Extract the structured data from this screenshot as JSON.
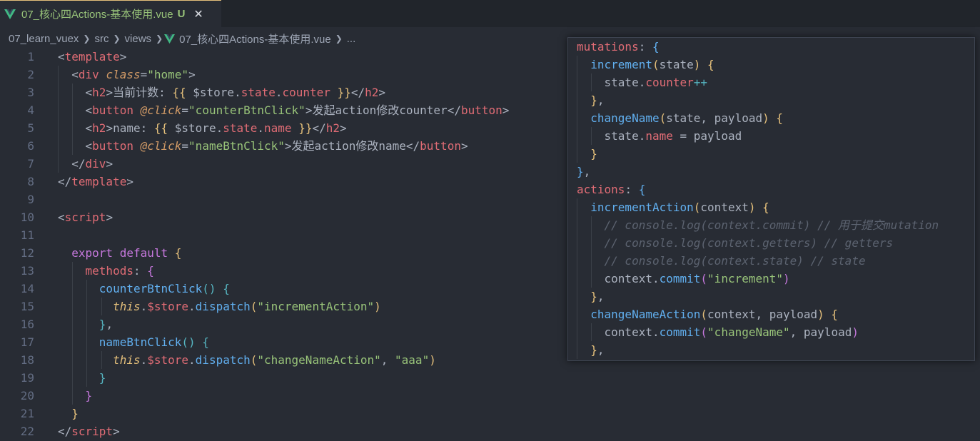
{
  "tab": {
    "title": "07_核心四Actions-基本使用.vue",
    "status": "U",
    "close": "✕"
  },
  "breadcrumb": {
    "items": [
      "07_learn_vuex",
      "src",
      "views",
      "07_核心四Actions-基本使用.vue",
      "..."
    ]
  },
  "colors": {
    "background": "#282c34",
    "tag": "#e06c75",
    "string": "#98c379",
    "attribute": "#d19a66",
    "function": "#61afef",
    "keyword": "#c678dd",
    "comment": "#5c6370",
    "vue_icon": "#41b883"
  },
  "editor": {
    "line_numbers": [
      "1",
      "2",
      "3",
      "4",
      "5",
      "6",
      "7",
      "8",
      "9",
      "10",
      "11",
      "12",
      "13",
      "14",
      "15",
      "16",
      "17",
      "18",
      "19",
      "20",
      "21",
      "22"
    ],
    "l1": {
      "a": "<",
      "b": "template",
      "c": ">"
    },
    "l2": {
      "a": "<",
      "b": "div",
      "c": "class",
      "d": "=",
      "e": "\"home\"",
      "f": ">"
    },
    "l3": {
      "a": "<",
      "b": "h2",
      "c": ">",
      "d": "当前计数: ",
      "e": "{{",
      "f": " $store",
      "g": ".",
      "h": "state",
      "i": ".",
      "j": "counter",
      "k": " }}",
      "l": "</",
      "m": "h2",
      "n": ">"
    },
    "l4": {
      "a": "<",
      "b": "button",
      "c": " @click",
      "d": "=",
      "e": "\"counterBtnClick\"",
      "f": ">",
      "g": "发起action修改counter",
      "h": "</",
      "i": "button",
      "j": ">"
    },
    "l5": {
      "a": "<",
      "b": "h2",
      "c": ">",
      "d": "name: ",
      "e": "{{",
      "f": " $store",
      "g": ".",
      "h": "state",
      "i": ".",
      "j": "name",
      "k": " }}",
      "l": "</",
      "m": "h2",
      "n": ">"
    },
    "l6": {
      "a": "<",
      "b": "button",
      "c": " @click",
      "d": "=",
      "e": "\"nameBtnClick\"",
      "f": ">",
      "g": "发起action修改name",
      "h": "</",
      "i": "button",
      "j": ">"
    },
    "l7": {
      "a": "</",
      "b": "div",
      "c": ">"
    },
    "l8": {
      "a": "</",
      "b": "template",
      "c": ">"
    },
    "l10": {
      "a": "<",
      "b": "script",
      "c": ">"
    },
    "l12": {
      "a": "export",
      "b": " default",
      "c": " {"
    },
    "l13": {
      "a": "methods",
      "b": ": ",
      "c": "{"
    },
    "l14": {
      "a": "counterBtnClick",
      "b": "()",
      "c": " {"
    },
    "l15": {
      "a": "this",
      "b": ".",
      "c": "$store",
      "d": ".",
      "e": "dispatch",
      "f": "(",
      "g": "\"incrementAction\"",
      "h": ")"
    },
    "l16": {
      "a": "}",
      "b": ","
    },
    "l17": {
      "a": "nameBtnClick",
      "b": "()",
      "c": " {"
    },
    "l18": {
      "a": "this",
      "b": ".",
      "c": "$store",
      "d": ".",
      "e": "dispatch",
      "f": "(",
      "g": "\"changeNameAction\"",
      "h": ", ",
      "i": "\"aaa\"",
      "j": ")"
    },
    "l19": {
      "a": "}"
    },
    "l20": {
      "a": "}"
    },
    "l21": {
      "a": "}"
    },
    "l22": {
      "a": "</",
      "b": "script",
      "c": ">"
    }
  },
  "peek": {
    "p1": {
      "a": "mutations",
      "b": ": ",
      "c": "{"
    },
    "p2": {
      "a": "increment",
      "b": "(",
      "c": "state",
      "d": ")",
      "e": " {"
    },
    "p3": {
      "a": "state",
      "b": ".",
      "c": "counter",
      "d": "++"
    },
    "p4": {
      "a": "}",
      "b": ","
    },
    "p5": {
      "a": "changeName",
      "b": "(",
      "c": "state, payload",
      "d": ")",
      "e": " {"
    },
    "p6": {
      "a": "state",
      "b": ".",
      "c": "name",
      "d": " = ",
      "e": "payload"
    },
    "p7": {
      "a": "}"
    },
    "p8": {
      "a": "}",
      "b": ","
    },
    "p9": {
      "a": "actions",
      "b": ": ",
      "c": "{"
    },
    "p10": {
      "a": "incrementAction",
      "b": "(",
      "c": "context",
      "d": ")",
      "e": " {"
    },
    "p11": {
      "a": "// console.log(context.commit) // 用于提交mutation"
    },
    "p12": {
      "a": "// console.log(context.getters) // getters"
    },
    "p13": {
      "a": "// console.log(context.state) // state"
    },
    "p14": {
      "a": "context",
      "b": ".",
      "c": "commit",
      "d": "(",
      "e": "\"increment\"",
      "f": ")"
    },
    "p15": {
      "a": "}",
      "b": ","
    },
    "p16": {
      "a": "changeNameAction",
      "b": "(",
      "c": "context, payload",
      "d": ")",
      "e": " {"
    },
    "p17": {
      "a": "context",
      "b": ".",
      "c": "commit",
      "d": "(",
      "e": "\"changeName\"",
      "f": ", payload",
      "g": ")"
    },
    "p18": {
      "a": "}",
      "b": ","
    }
  }
}
